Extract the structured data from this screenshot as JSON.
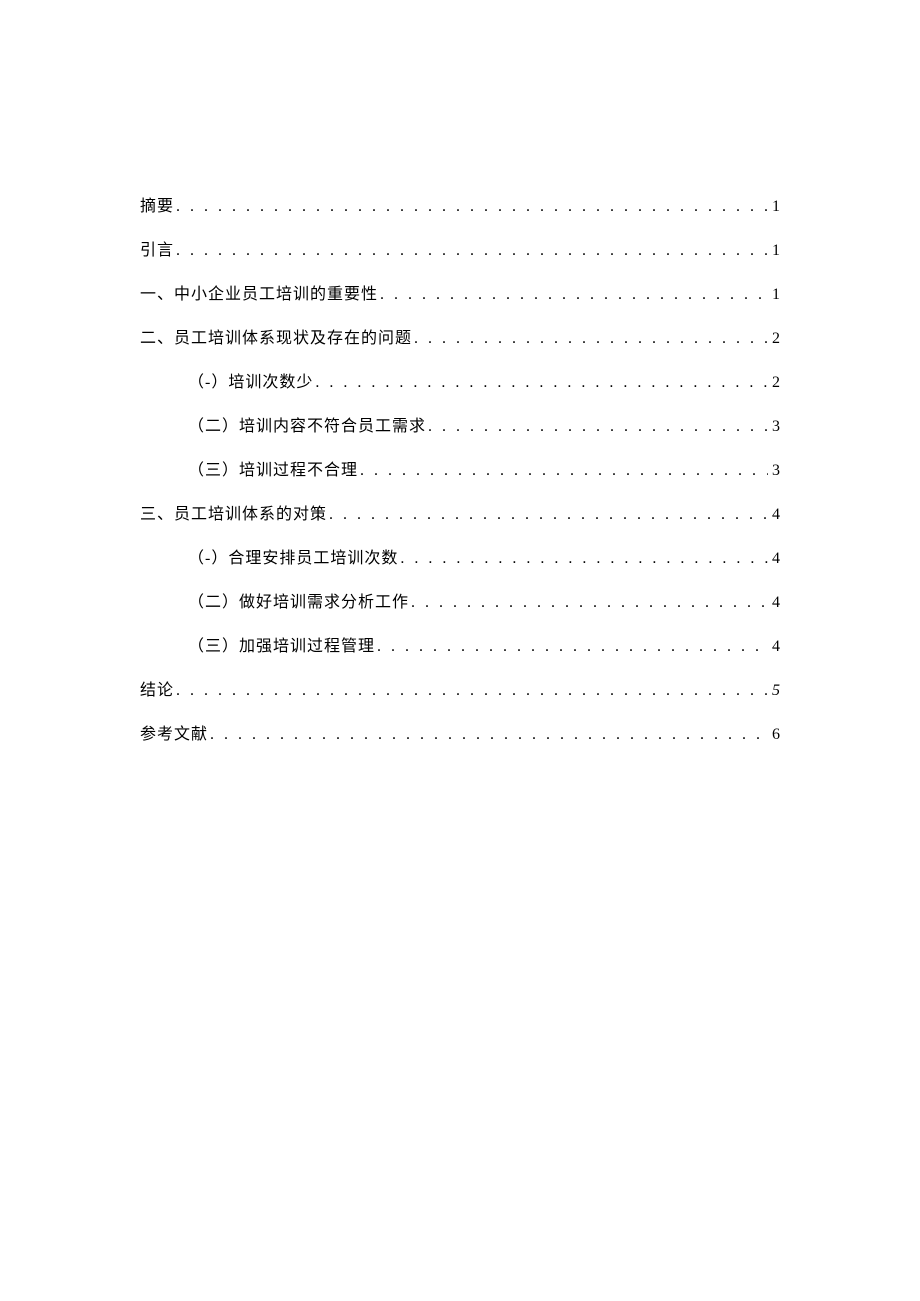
{
  "toc": [
    {
      "level": 1,
      "title": "摘要",
      "page": "1",
      "italic": false
    },
    {
      "level": 1,
      "title": "引言",
      "page": "1",
      "italic": false
    },
    {
      "level": 1,
      "title": "一、中小企业员工培训的重要性",
      "page": "1",
      "italic": false
    },
    {
      "level": 1,
      "title": "二、员工培训体系现状及存在的问题",
      "page": "2",
      "italic": false
    },
    {
      "level": 2,
      "title": "（-）培训次数少",
      "page": "2",
      "italic": false
    },
    {
      "level": 2,
      "title": "（二）培训内容不符合员工需求",
      "page": "3",
      "italic": false
    },
    {
      "level": 2,
      "title": "（三）培训过程不合理",
      "page": "3",
      "italic": false
    },
    {
      "level": 1,
      "title": "三、员工培训体系的对策",
      "page": "4",
      "italic": false
    },
    {
      "level": 2,
      "title": "（-）合理安排员工培训次数",
      "page": "4",
      "italic": false
    },
    {
      "level": 2,
      "title": "（二）做好培训需求分析工作",
      "page": "4",
      "italic": false
    },
    {
      "level": 2,
      "title": "（三）加强培训过程管理",
      "page": "4",
      "italic": false
    },
    {
      "level": 1,
      "title": "结论",
      "page": "5",
      "italic": true
    },
    {
      "level": 1,
      "title": "参考文献",
      "page": "6",
      "italic": false
    }
  ]
}
